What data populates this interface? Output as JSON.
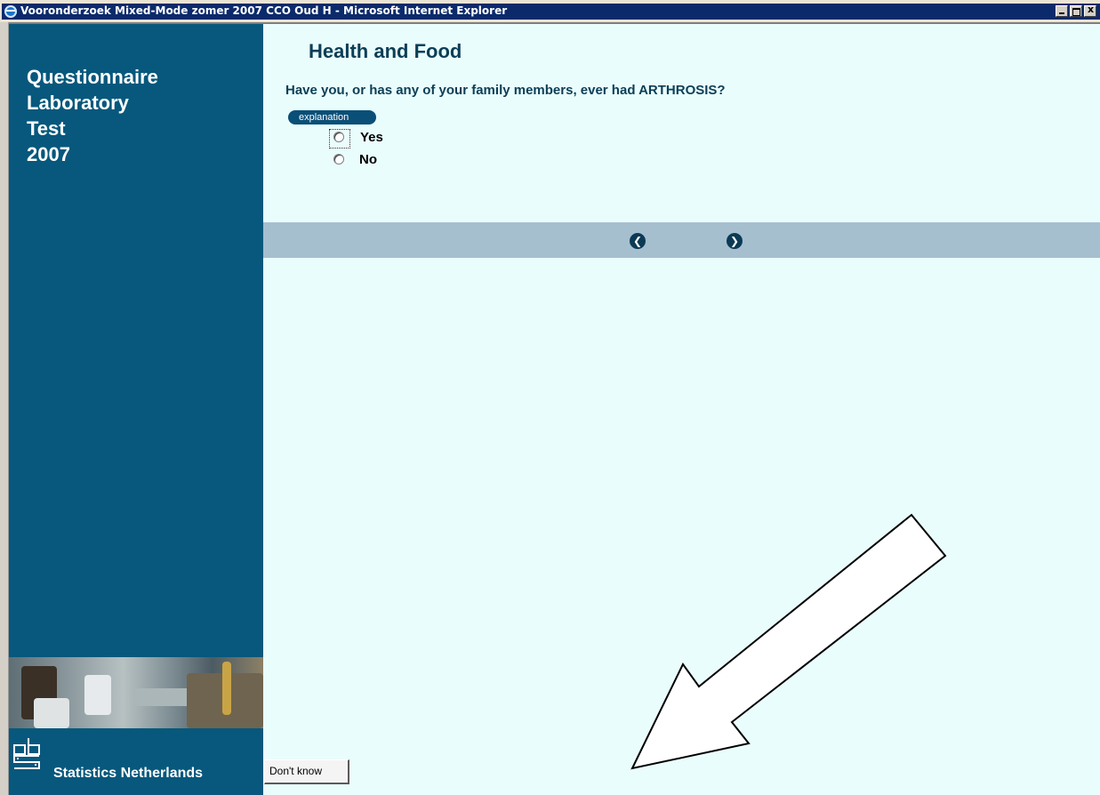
{
  "window": {
    "title": "Vooronderzoek Mixed-Mode zomer 2007 CCO Oud H - Microsoft Internet Explorer",
    "controls": [
      "minimize-icon",
      "maximize-icon",
      "close-icon"
    ]
  },
  "sidebar": {
    "title_lines": [
      "Questionnaire",
      "Laboratory",
      "Test",
      "2007"
    ],
    "brand": "Statistics Netherlands",
    "background": "#07587c"
  },
  "main": {
    "section_title": "Health and Food",
    "question": "Have you, or has any of your family members, ever had ARTHROSIS?",
    "explanation_label": "explanation",
    "options": [
      {
        "label": "Yes",
        "selected": false,
        "focused": true
      },
      {
        "label": "No",
        "selected": false,
        "focused": false
      }
    ],
    "nav": {
      "prev_icon": "chevron-left-icon",
      "next_icon": "chevron-right-icon"
    },
    "dont_know_label": "Don't know",
    "background": "#eafdfd"
  },
  "colors": {
    "titlebar": "#0b2a6b",
    "nav_bar": "#a6bfcf",
    "heading": "#0c3e56"
  }
}
